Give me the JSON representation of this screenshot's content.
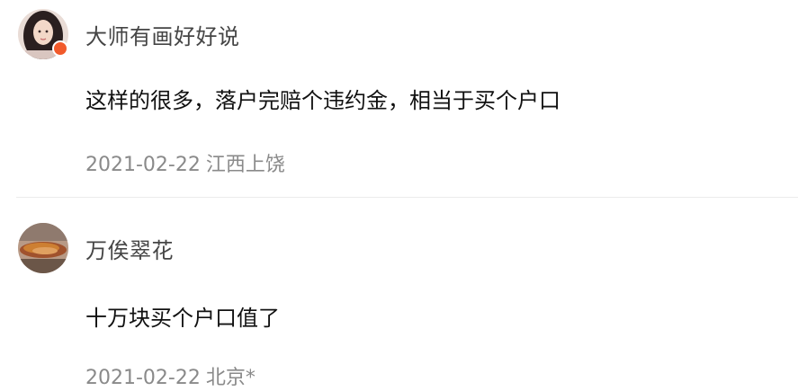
{
  "comments": [
    {
      "username": "大师有画好好说",
      "content": "这样的很多，落户完赔个违约金，相当于买个户口",
      "date": "2021-02-22",
      "location": "江西上饶"
    },
    {
      "username": "万俟翠花",
      "content": "十万块买个户口值了",
      "date": "2021-02-22",
      "location": "北京*"
    }
  ],
  "colors": {
    "username": "#454545",
    "content": "#111111",
    "meta": "#8a8a8a",
    "divider": "#ececec",
    "badge": "#f15a2b"
  },
  "icons": {
    "avatar_1": "user-avatar-portrait",
    "avatar_2": "user-avatar-food-photo",
    "badge": "vip-badge-icon"
  }
}
